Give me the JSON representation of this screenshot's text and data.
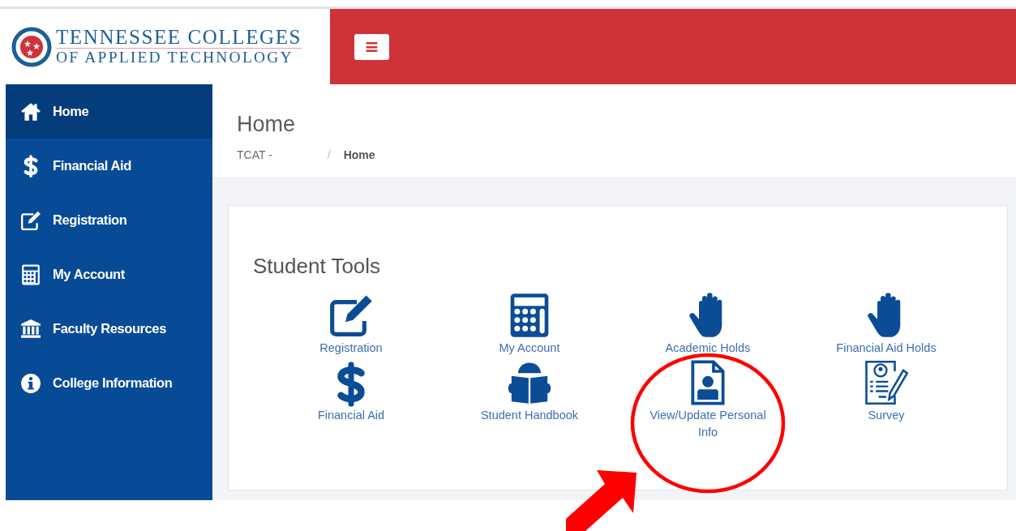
{
  "logo": {
    "line_1": "TENNESSEE COLLEGES",
    "line_2": "OF APPLIED TECHNOLOGY"
  },
  "header": {
    "menu_button": "≡"
  },
  "sidebar": {
    "items": [
      {
        "label": "Home",
        "kind": "home",
        "selected": true
      },
      {
        "label": "Financial Aid",
        "kind": "dollar",
        "selected": false
      },
      {
        "label": "Registration",
        "kind": "edit",
        "selected": false
      },
      {
        "label": "My Account",
        "kind": "calculator",
        "selected": false
      },
      {
        "label": "Faculty Resources",
        "kind": "bank",
        "selected": false
      },
      {
        "label": "College Information",
        "kind": "info",
        "selected": false
      }
    ]
  },
  "page": {
    "title": "Home",
    "breadcrumb": {
      "parent": "TCAT -",
      "separator": "/",
      "current": "Home"
    }
  },
  "card": {
    "title": "Student Tools",
    "tools": [
      {
        "label": "Registration",
        "kind": "edit"
      },
      {
        "label": "My Account",
        "kind": "calculator"
      },
      {
        "label": "Academic Holds",
        "kind": "hand"
      },
      {
        "label": "Financial Aid Holds",
        "kind": "hand"
      },
      {
        "label": "Financial Aid",
        "kind": "dollar"
      },
      {
        "label": "Student Handbook",
        "kind": "reader"
      },
      {
        "label": "View/Update Personal Info",
        "kind": "id-file"
      },
      {
        "label": "Survey",
        "kind": "survey"
      }
    ]
  }
}
